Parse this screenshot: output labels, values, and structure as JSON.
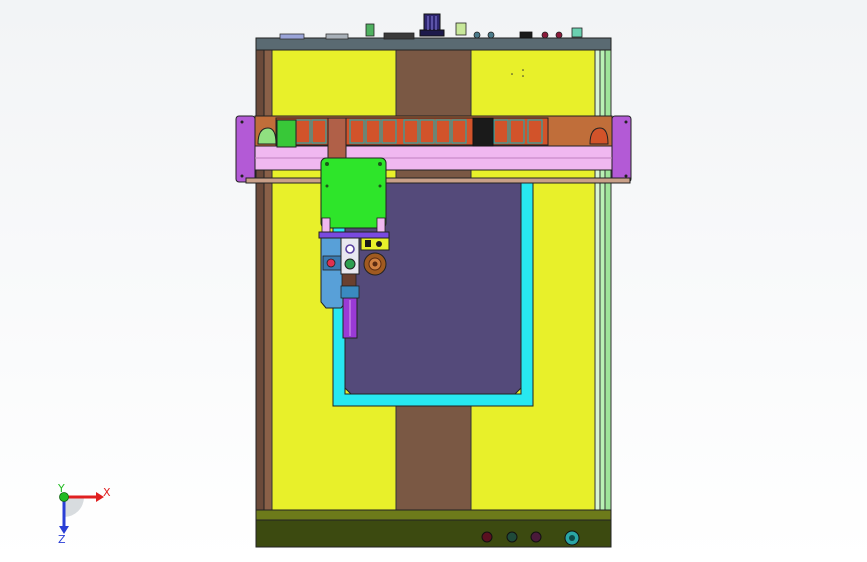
{
  "triad": {
    "x_label": "X",
    "y_label": "Y",
    "z_label": "Z",
    "x_color": "#e02020",
    "y_color": "#22bb22",
    "z_color": "#2a3fd6"
  },
  "colors": {
    "background_top": "#f2f4f6",
    "table_yellow": "#e8f02a",
    "center_strip": "#7a5844",
    "top_rail": "#5a6a72",
    "base_plate": "#3c4a10",
    "gantry_magenta": "#b35ad6",
    "gantry_pink": "#f0b8f0",
    "chain_orange": "#d2532a",
    "carriage_green": "#2ee52a",
    "fixture_cyan": "#28e8f0",
    "fixture_purple": "#544a7a",
    "right_rail_green": "#b9f0b4"
  }
}
